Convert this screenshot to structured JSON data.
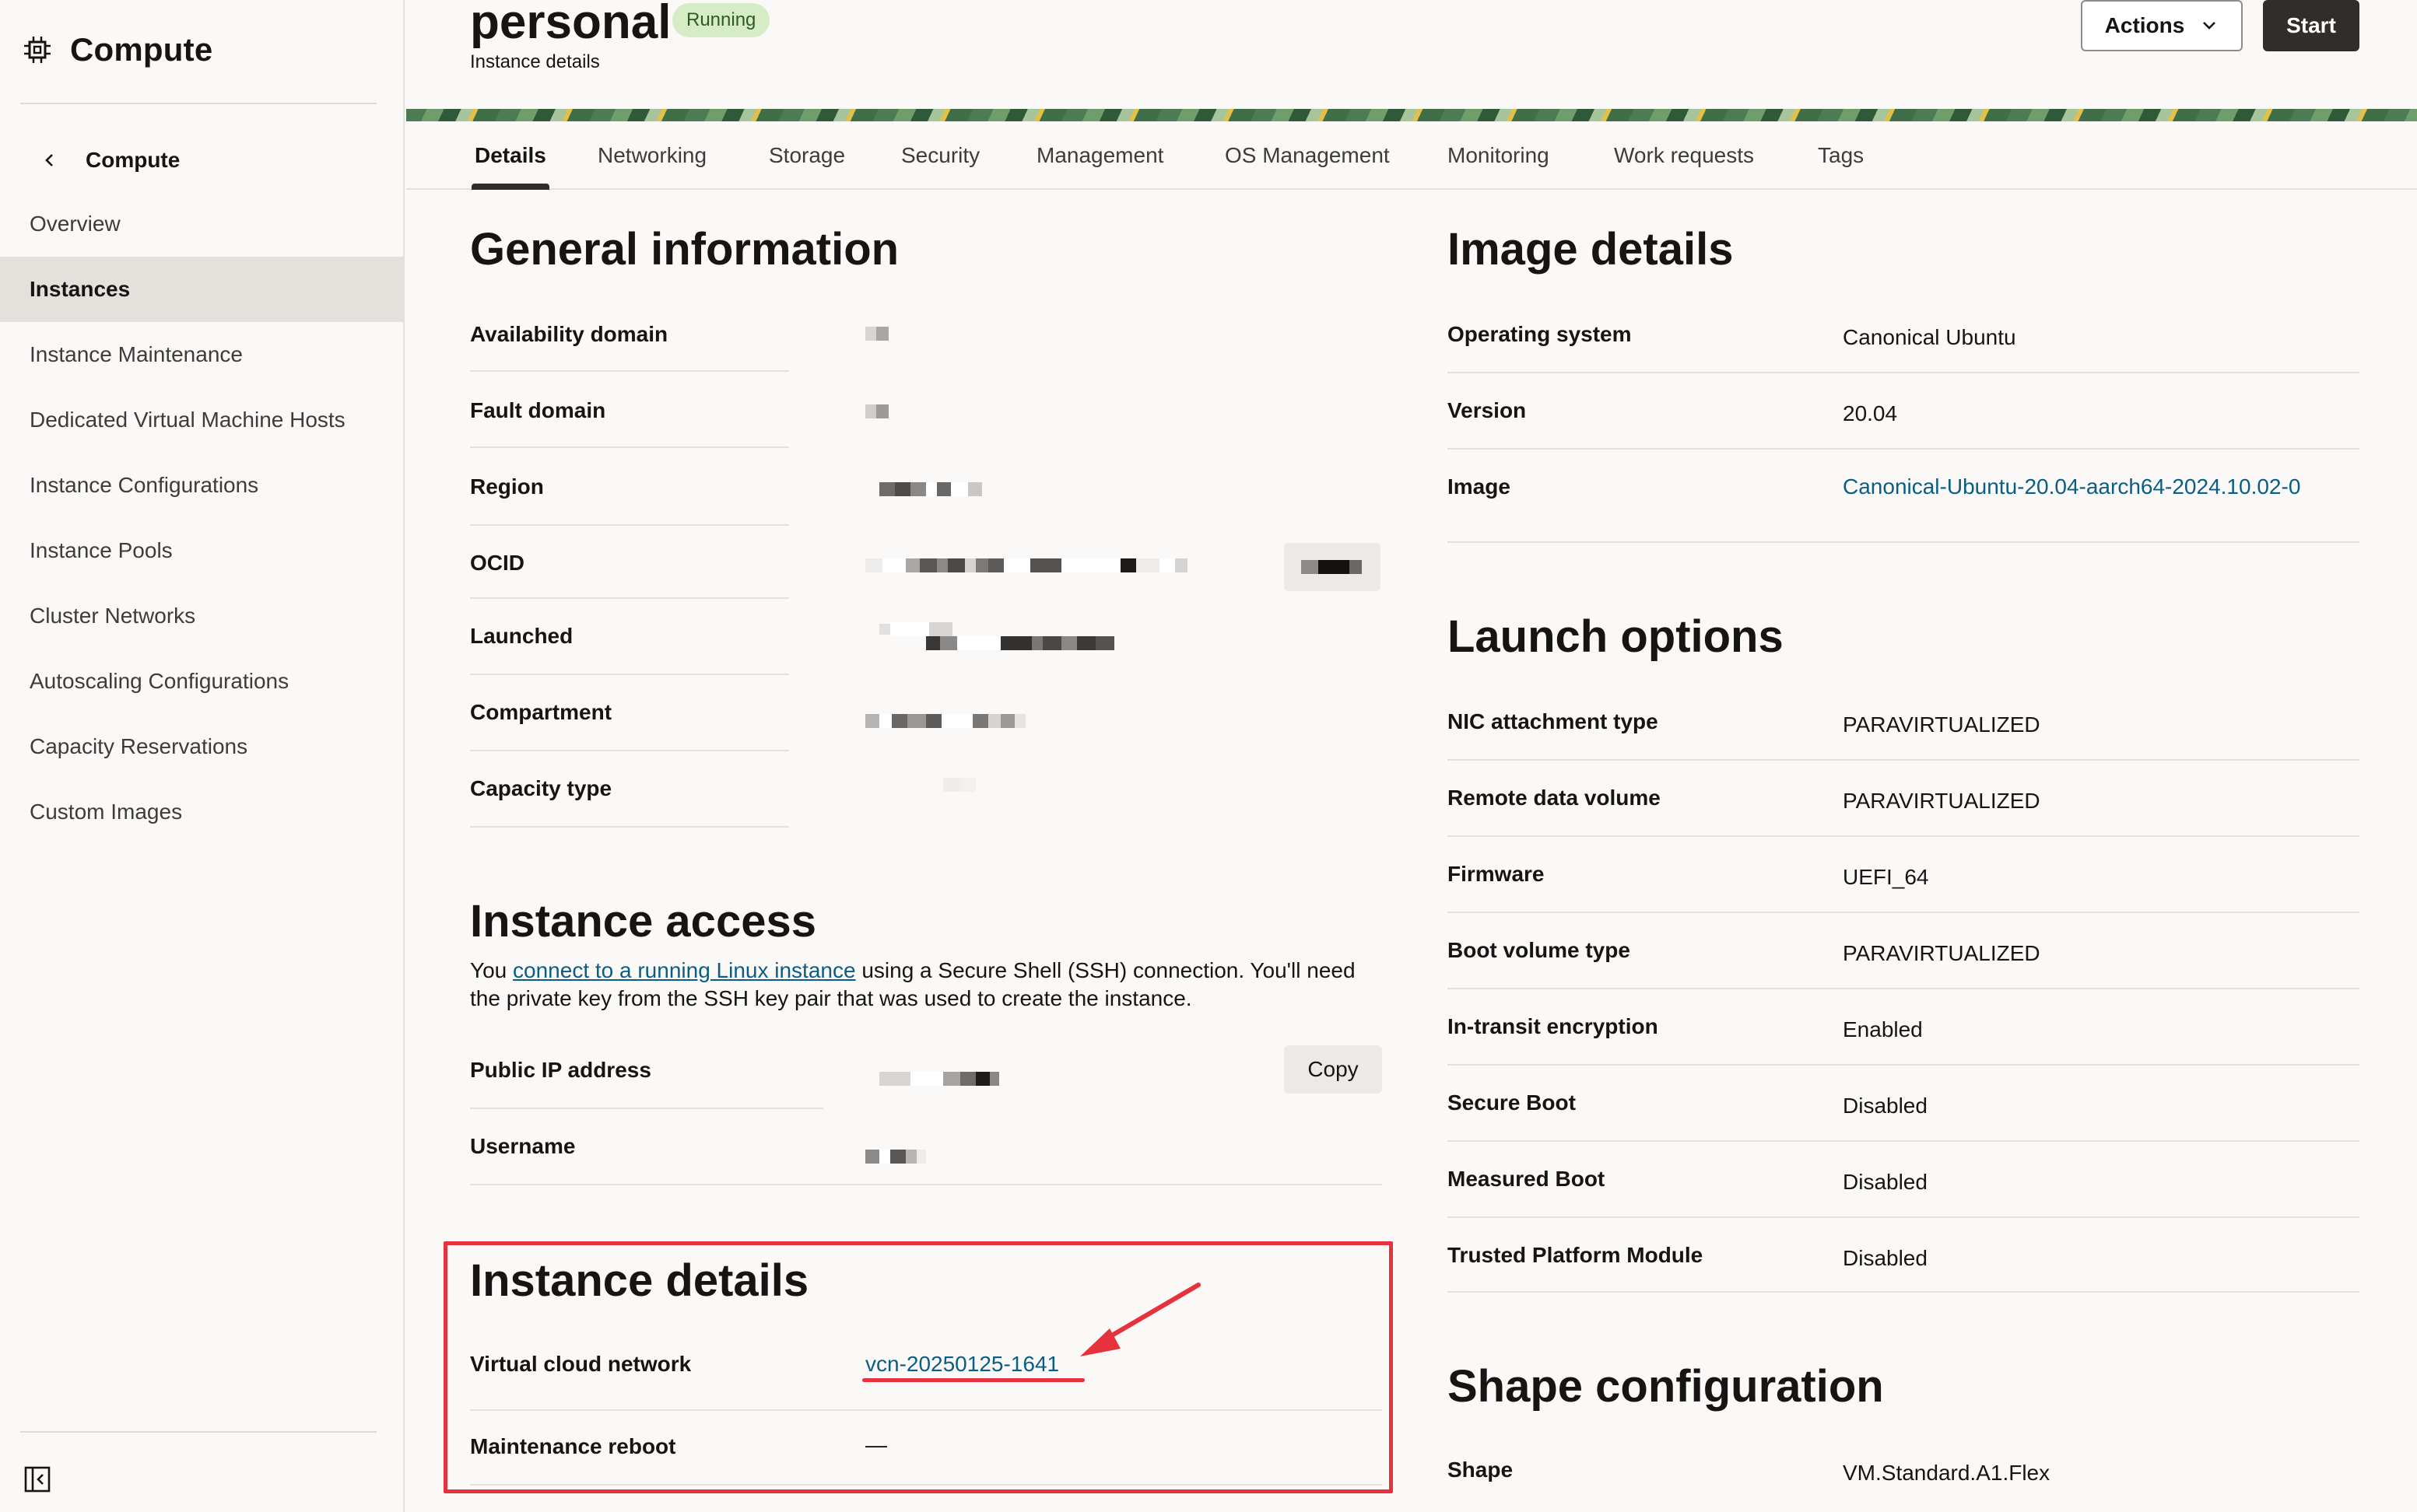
{
  "sidebar": {
    "service_title": "Compute",
    "back_label": "Compute",
    "items": [
      {
        "label": "Overview"
      },
      {
        "label": "Instances"
      },
      {
        "label": "Instance Maintenance"
      },
      {
        "label": "Dedicated Virtual Machine Hosts"
      },
      {
        "label": "Instance Configurations"
      },
      {
        "label": "Instance Pools"
      },
      {
        "label": "Cluster Networks"
      },
      {
        "label": "Autoscaling Configurations"
      },
      {
        "label": "Capacity Reservations"
      },
      {
        "label": "Custom Images"
      }
    ],
    "active_item": "Instances"
  },
  "header": {
    "title": "personal",
    "status": "Running",
    "subtitle": "Instance details",
    "actions_label": "Actions",
    "start_label": "Start"
  },
  "tabs": [
    {
      "label": "Details"
    },
    {
      "label": "Networking"
    },
    {
      "label": "Storage"
    },
    {
      "label": "Security"
    },
    {
      "label": "Management"
    },
    {
      "label": "OS Management"
    },
    {
      "label": "Monitoring"
    },
    {
      "label": "Work requests"
    },
    {
      "label": "Tags"
    }
  ],
  "active_tab": "Details",
  "general_information": {
    "heading": "General information",
    "rows": [
      {
        "label": "Availability domain"
      },
      {
        "label": "Fault domain"
      },
      {
        "label": "Region"
      },
      {
        "label": "OCID"
      },
      {
        "label": "Launched"
      },
      {
        "label": "Compartment"
      },
      {
        "label": "Capacity type"
      }
    ]
  },
  "instance_access": {
    "heading": "Instance access",
    "text_before": "You ",
    "link_text": "connect to a running Linux instance",
    "text_after": " using a Secure Shell (SSH) connection. You'll need the private key from the SSH key pair that was used to create the instance.",
    "public_ip_label": "Public IP address",
    "copy_label": "Copy",
    "username_label": "Username"
  },
  "instance_details": {
    "heading": "Instance details",
    "vcn_label": "Virtual cloud network",
    "vcn_value": "vcn-20250125-1641",
    "maintenance_label": "Maintenance reboot",
    "maintenance_value": "—"
  },
  "image_details": {
    "heading": "Image details",
    "rows": [
      {
        "label": "Operating system",
        "value": "Canonical Ubuntu"
      },
      {
        "label": "Version",
        "value": "20.04"
      },
      {
        "label": "Image",
        "value": "Canonical-Ubuntu-20.04-aarch64-2024.10.02-0"
      }
    ]
  },
  "launch_options": {
    "heading": "Launch options",
    "rows": [
      {
        "label": "NIC attachment type",
        "value": "PARAVIRTUALIZED"
      },
      {
        "label": "Remote data volume",
        "value": "PARAVIRTUALIZED"
      },
      {
        "label": "Firmware",
        "value": "UEFI_64"
      },
      {
        "label": "Boot volume type",
        "value": "PARAVIRTUALIZED"
      },
      {
        "label": "In-transit encryption",
        "value": "Enabled"
      },
      {
        "label": "Secure Boot",
        "value": "Disabled"
      },
      {
        "label": "Measured Boot",
        "value": "Disabled"
      },
      {
        "label": "Trusted Platform Module",
        "value": "Disabled"
      }
    ]
  },
  "shape_configuration": {
    "heading": "Shape configuration",
    "rows": [
      {
        "label": "Shape",
        "value": "VM.Standard.A1.Flex"
      }
    ]
  },
  "colors": {
    "link": "#0a5d84",
    "running_badge_bg": "#d6ecc6",
    "annotation_red": "#e5323c",
    "primary_button": "#312d2a"
  }
}
